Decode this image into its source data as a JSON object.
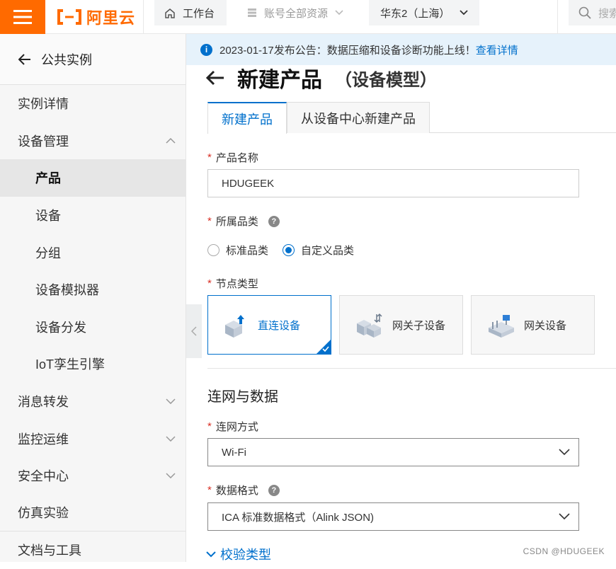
{
  "topbar": {
    "logo_text": "阿里云",
    "workbench": "工作台",
    "resources": "账号全部资源",
    "region": "华东2（上海）",
    "search": "搜索"
  },
  "sidebar": {
    "back_label": "公共实例",
    "items": [
      {
        "label": "实例详情"
      },
      {
        "label": "设备管理"
      },
      {
        "label": "产品"
      },
      {
        "label": "设备"
      },
      {
        "label": "分组"
      },
      {
        "label": "设备模拟器"
      },
      {
        "label": "设备分发"
      },
      {
        "label": "IoT孪生引擎"
      },
      {
        "label": "消息转发"
      },
      {
        "label": "监控运维"
      },
      {
        "label": "安全中心"
      },
      {
        "label": "仿真实验"
      },
      {
        "label": "文档与工具"
      }
    ]
  },
  "notice": {
    "text": "2023-01-17发布公告：数据压缩和设备诊断功能上线！",
    "link": "查看详情"
  },
  "page": {
    "title": "新建产品",
    "subtitle": "（设备模型）",
    "tabs": [
      {
        "label": "新建产品"
      },
      {
        "label": "从设备中心新建产品"
      }
    ]
  },
  "form": {
    "product_name_label": "产品名称",
    "product_name_value": "HDUGEEK",
    "category_label": "所属品类",
    "category_options": [
      {
        "label": "标准品类"
      },
      {
        "label": "自定义品类"
      }
    ],
    "node_type_label": "节点类型",
    "node_types": [
      {
        "label": "直连设备"
      },
      {
        "label": "网关子设备"
      },
      {
        "label": "网关设备"
      }
    ],
    "section_title": "连网与数据",
    "network_label": "连网方式",
    "network_value": "Wi-Fi",
    "data_format_label": "数据格式",
    "data_format_value": "ICA 标准数据格式（Alink JSON)",
    "verify_label": "校验类型",
    "required_mark": "*"
  },
  "watermark": "CSDN @HDUGEEK",
  "colors": {
    "accent": "#ff6a00",
    "primary": "#0070cc"
  }
}
